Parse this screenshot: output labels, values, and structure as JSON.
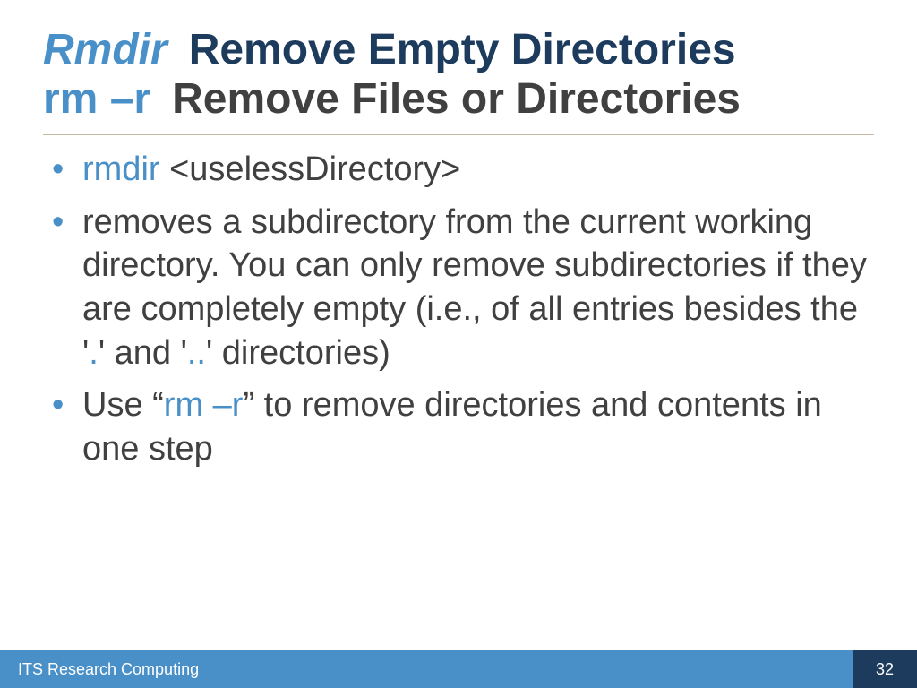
{
  "title": {
    "row1": {
      "cmd": "Rmdir",
      "desc": "Remove Empty Directories"
    },
    "row2": {
      "cmd": "rm –r",
      "desc": "Remove Files or Directories"
    }
  },
  "bullets": {
    "b1": {
      "cmd": "rmdir",
      "arg": " <uselessDirectory>"
    },
    "b2": {
      "t1": "removes a subdirectory from the current working directory. You can only remove subdirectories if they are completely empty (i.e., of all entries besides the '",
      "dot": ".",
      "t2": "' and '",
      "dotdot": "..",
      "t3": "' directories)"
    },
    "b3": {
      "t1": "Use “",
      "cmd": "rm –r",
      "t2": "” to remove directories and contents in one step"
    }
  },
  "footer": {
    "org": "ITS Research Computing",
    "page": "32"
  }
}
